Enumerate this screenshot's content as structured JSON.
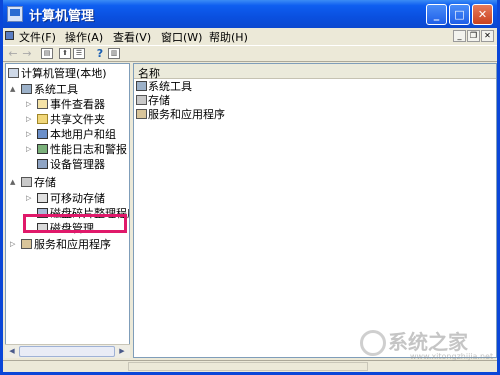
{
  "window": {
    "title": "计算机管理"
  },
  "colors": {
    "title_bar": "#0a50e0",
    "highlight_box": "#e0196a",
    "face": "#ece9d8"
  },
  "menubar": {
    "items": [
      {
        "label": "文件(F)"
      },
      {
        "label": "操作(A)"
      },
      {
        "label": "查看(V)"
      },
      {
        "label": "窗口(W)"
      },
      {
        "label": "帮助(H)"
      }
    ]
  },
  "toolbar": {
    "icons": [
      "back-arrow-icon",
      "forward-arrow-icon",
      "show-hide-console-tree-icon",
      "up-one-level-icon",
      "properties-icon",
      "help-icon",
      "show-hide-action-pane-icon"
    ]
  },
  "tree": {
    "root": "计算机管理(本地)",
    "system_tools": "系统工具",
    "event_viewer": "事件查看器",
    "shared_folders": "共享文件夹",
    "local_users": "本地用户和组",
    "perf_logs": "性能日志和警报",
    "device_manager": "设备管理器",
    "storage": "存储",
    "removable": "可移动存储",
    "defrag": "磁盘碎片整理程序",
    "disk_mgmt": "磁盘管理",
    "services": "服务和应用程序"
  },
  "details": {
    "column_name": "名称",
    "rows": [
      "系统工具",
      "存储",
      "服务和应用程序"
    ]
  },
  "watermark": {
    "text": "系统之家",
    "url": "www.xitongzhijia.net"
  }
}
